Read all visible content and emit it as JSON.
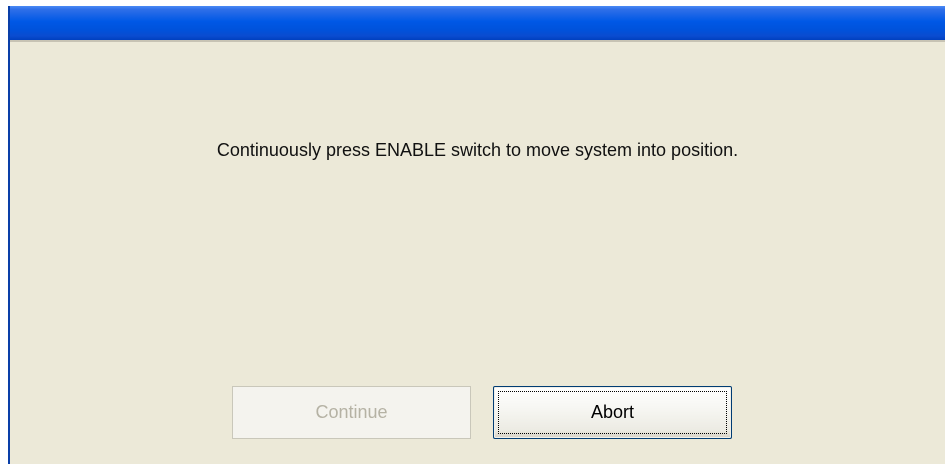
{
  "window": {
    "title": ""
  },
  "dialog": {
    "message": "Continuously press ENABLE switch to move system into position."
  },
  "buttons": {
    "continue_label": "Continue",
    "continue_enabled": false,
    "abort_label": "Abort",
    "abort_focused": true
  },
  "colors": {
    "titlebar": "#0058e6",
    "window_bg": "#ece9d8",
    "disabled_text": "#b5b2a4"
  }
}
